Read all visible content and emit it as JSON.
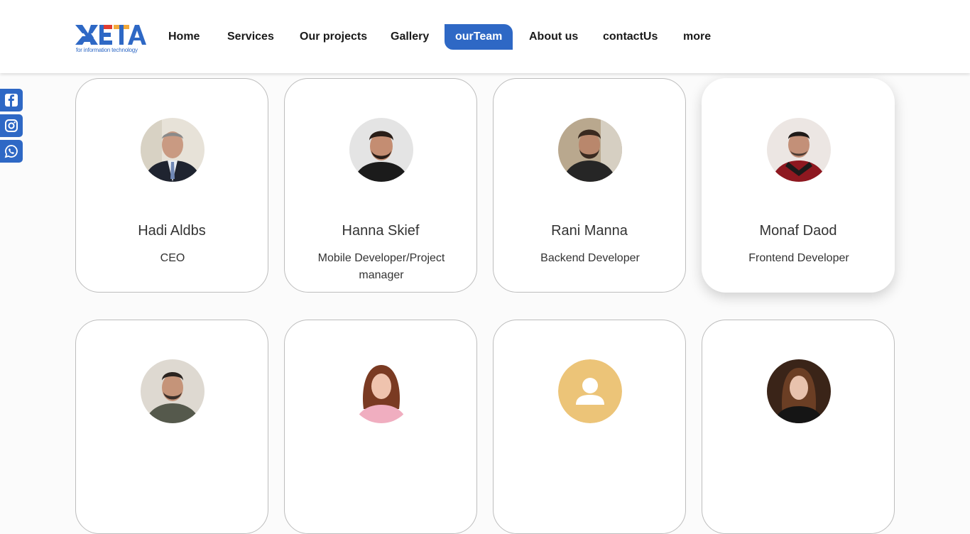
{
  "brand": {
    "logo_text": "META",
    "logo_tagline": "for information technology"
  },
  "nav": {
    "items": [
      {
        "label": "Home"
      },
      {
        "label": "Services"
      },
      {
        "label": "Our projects"
      },
      {
        "label": "Gallery"
      },
      {
        "label": "ourTeam",
        "active": true
      },
      {
        "label": "About us"
      },
      {
        "label": "contactUs"
      },
      {
        "label": "more"
      }
    ]
  },
  "social": [
    "facebook-icon",
    "instagram-icon",
    "whatsapp-icon"
  ],
  "team": [
    {
      "name": "Hadi Aldbs",
      "role": "CEO"
    },
    {
      "name": "Hanna Skief",
      "role": "Mobile Developer/Project manager"
    },
    {
      "name": "Rani Manna",
      "role": "Backend Developer"
    },
    {
      "name": "Monaf Daod",
      "role": "Frontend Developer"
    },
    {
      "name": "",
      "role": ""
    },
    {
      "name": "",
      "role": ""
    },
    {
      "name": "",
      "role": ""
    },
    {
      "name": "",
      "role": ""
    }
  ],
  "colors": {
    "accent": "#2e68c5",
    "placeholder_avatar": "#ecc478"
  }
}
